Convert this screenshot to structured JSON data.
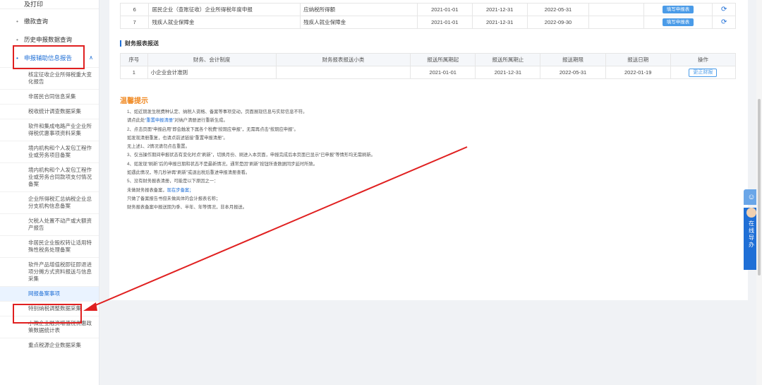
{
  "sidebar": {
    "top_partial": "及打印",
    "items": [
      {
        "label": "缴款查询"
      },
      {
        "label": "历史申报数据查询"
      },
      {
        "label": "申报辅助信息报告"
      }
    ],
    "sub_items": [
      "核定征收企业所得税重大变化报告",
      "非居民合同信息采集",
      "税收统计调查数据采集",
      "软件和集成电路产业企业所得税优惠事项资料采集",
      "境内机构和个人发包工程作业或劳务项目备案",
      "境内机构和个人发包工程作业或劳务合同款项支付情况备案",
      "企业所得税汇总纳税企业总分支机构信息备案",
      "欠税人处置不动产或大额资产报告",
      "非居民企业股权转让适用特殊性税务处理备案",
      "软件产品增值税即征即退进项分摊方式资料报送与信息采集",
      "网报备案事项",
      "特别纳税调整数据采集",
      "小微企业融资增值税优惠政策数据统计表",
      "重点税源企业数据采集"
    ]
  },
  "top_table": {
    "rows": [
      {
        "no": "6",
        "name": "居民企业（查账征收）企业所得税年度申报",
        "type": "应纳税所得额",
        "start": "2021-01-01",
        "end": "2021-12-31",
        "deadline": "2022-05-31",
        "date": "",
        "action": "填写申报表"
      },
      {
        "no": "7",
        "name": "残疾人就业保障金",
        "type": "残疾人就业保障金",
        "start": "2021-01-01",
        "end": "2021-12-31",
        "deadline": "2022-09-30",
        "date": "",
        "action": "填写申报表"
      }
    ]
  },
  "finance": {
    "title": "财务报表报送",
    "headers": [
      "序号",
      "财务、会计制度",
      "财务报表报送小类",
      "报送所属期起",
      "报送所属期止",
      "报送期限",
      "报送日期",
      "操作"
    ],
    "rows": [
      {
        "no": "1",
        "system": "小企业会计准则",
        "subtype": "",
        "start": "2021-01-01",
        "end": "2021-12-31",
        "deadline": "2022-05-31",
        "date": "2022-01-19",
        "action": "更正财报"
      }
    ]
  },
  "tips": {
    "title": "温馨提示",
    "line1": "1、如近期发生税费种认定、纳税人资格、备案等事项变动，页面展现信息与实际信息不符。",
    "line2_pre": "请点此处",
    "line2_link": "“重置申报清册”",
    "line2_post": "对纳户清册进行重新生成。",
    "line3": "2、点击页面“申报启用”即会触发下属各个税费“按期应申报”，无需再点击“按期应申报”。",
    "line4": "如发现清册重复，也请点前述链接“重置申报清册”。",
    "line5": "无上述1、2情况请勿点击重置。",
    "line6": "3、仅当操作期间申报状态有变化时点“刷新”，切换月份、刷进入本页面，申报完成后本页面已显示“已申报”等情形均无需刷新。",
    "line7": "4、如发现“刷新”后的申报日期和状态不是最新情况，通常是因“刷新”按钮所查数据同步延时所致。",
    "line8": "如遇此情况，等几秒钟再“刷新”或退出税后重进申报清册查看。",
    "line9": "5、没有财务报表清册，可能是以下原因之一：",
    "line10_pre": "未做财务报表备案，",
    "line10_link": "现在步备案；",
    "line11": "只做了备案报告书但未做具体的会计报表名称；",
    "line12": "财务报表备案中报送期为季、半年、年等情况，非本月报送。"
  },
  "float_widget": {
    "label": "在线导办"
  },
  "colors": {
    "accent": "#1f6fd6",
    "highlight": "#e02020",
    "tips_title": "#f08a24"
  }
}
